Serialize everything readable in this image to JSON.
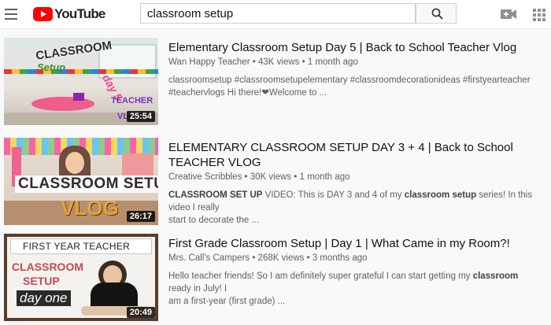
{
  "header": {
    "logo_text": "YouTube",
    "search_value": "classroom setup",
    "icons": {
      "menu": "hamburger-menu-icon",
      "search": "search-icon",
      "create": "video-camera-plus-icon",
      "apps": "apps-grid-icon"
    }
  },
  "colors": {
    "brand": "#ff0000",
    "meta": "#606060",
    "background": "#f9f9f9"
  },
  "results": [
    {
      "title": "Elementary Classroom Setup Day 5 | Back to School Teacher Vlog",
      "channel": "Wan Happy Teacher",
      "views": "43K views",
      "age": "1 month ago",
      "desc_line1": "classroomsetup #classroomsetupelementary #classroomdecorationideas #firstyearteacher",
      "desc_line2": "#teachervlogs Hi there!❤Welcome to ...",
      "duration": "25:54",
      "thumb_text": {
        "a": "CLASSROOM",
        "b": "Setup",
        "c": "day 5",
        "d": "TEACHER",
        "e": "VLOG"
      }
    },
    {
      "title_line1": "ELEMENTARY CLASSROOM SETUP DAY 3 + 4 | Back to School",
      "title_line2": "TEACHER VLOG",
      "channel": "Creative Scribbles",
      "views": "30K views",
      "age": "1 month ago",
      "desc_b1": "CLASSROOM SET UP",
      "desc_t1": " VIDEO: This is DAY 3 and 4 of my ",
      "desc_b2": "classroom",
      "desc_t2": " ",
      "desc_b3": "setup",
      "desc_t3": " series! In this video I really",
      "desc_line2": "start to decorate the ...",
      "duration": "26:17",
      "thumb_text": {
        "a": "CLASSROOM SETUP",
        "b": "VLOG"
      }
    },
    {
      "title": "First Grade Classroom Setup | Day 1 | What Came in my Room?!",
      "channel": "Mrs. Call's Campers",
      "views": "268K views",
      "age": "3 months ago",
      "desc_t1": "Hello teacher friends! So I am definitely super grateful I can start getting my ",
      "desc_b1": "classroom",
      "desc_t2": " ready in July! I",
      "desc_line2": "am a first-year (first grade) ...",
      "duration": "20:49",
      "thumb_text": {
        "a": "FIRST YEAR TEACHER",
        "b": "CLASSROOM",
        "c": "SETUP",
        "d": "day one"
      }
    }
  ]
}
